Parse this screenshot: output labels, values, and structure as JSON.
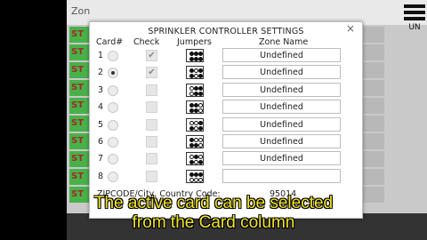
{
  "background": {
    "zone_label": "Zon",
    "menu_label": "UN",
    "row_label": "ST"
  },
  "modal": {
    "title": "SPRINKLER CONTROLLER SETTINGS",
    "close_icon": "×",
    "headers": {
      "card": "Card#",
      "check": "Check",
      "jumpers": "Jumpers",
      "zone_name": "Zone Name"
    },
    "rows": [
      {
        "num": "1",
        "selected": false,
        "checked": true,
        "zone": "Undefined"
      },
      {
        "num": "2",
        "selected": true,
        "checked": true,
        "zone": "Undefined"
      },
      {
        "num": "3",
        "selected": false,
        "checked": false,
        "zone": "Undefined"
      },
      {
        "num": "4",
        "selected": false,
        "checked": false,
        "zone": "Undefined"
      },
      {
        "num": "5",
        "selected": false,
        "checked": false,
        "zone": "Undefined"
      },
      {
        "num": "6",
        "selected": false,
        "checked": false,
        "zone": "Undefined"
      },
      {
        "num": "7",
        "selected": false,
        "checked": false,
        "zone": "Undefined"
      },
      {
        "num": "8",
        "selected": false,
        "checked": false,
        "zone": ""
      }
    ],
    "zip_label": "ZIPCODE/City, Country Code:",
    "zip_value": "95014"
  },
  "caption": {
    "line1": "The active card can be selected",
    "line2": "from the Card column"
  },
  "colors": {
    "caption": "#f2e629",
    "green_row": "#49b149",
    "row_text": "#a02b2b"
  }
}
